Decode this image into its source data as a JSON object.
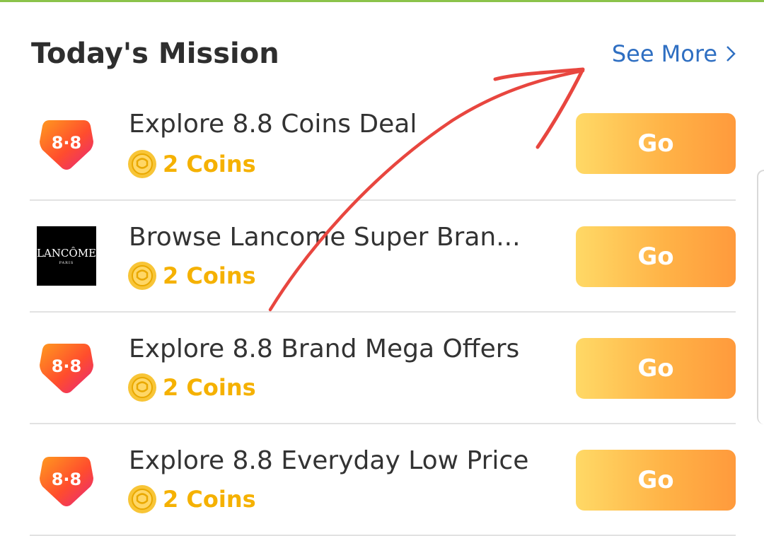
{
  "header": {
    "title": "Today's Mission",
    "see_more": "See More"
  },
  "missions": [
    {
      "title": "Explore 8.8 Coins Deal",
      "reward": "2 Coins",
      "button": "Go",
      "logo": "8.8-logo"
    },
    {
      "title": "Browse Lancome Super Bran...",
      "reward": "2 Coins",
      "button": "Go",
      "logo": "lancome-logo"
    },
    {
      "title": "Explore 8.8 Brand Mega Offers",
      "reward": "2 Coins",
      "button": "Go",
      "logo": "8.8-logo"
    },
    {
      "title": "Explore 8.8 Everyday Low Price",
      "reward": "2 Coins",
      "button": "Go",
      "logo": "8.8-logo"
    }
  ],
  "brand_logo": {
    "name": "LANCÔME",
    "sub": "PARIS"
  },
  "colors": {
    "accent_link": "#2f6fc2",
    "coin_text": "#f5b100",
    "button_start": "#ffd966",
    "button_end": "#ff9a3c",
    "annotation_arrow": "#e8463f"
  }
}
